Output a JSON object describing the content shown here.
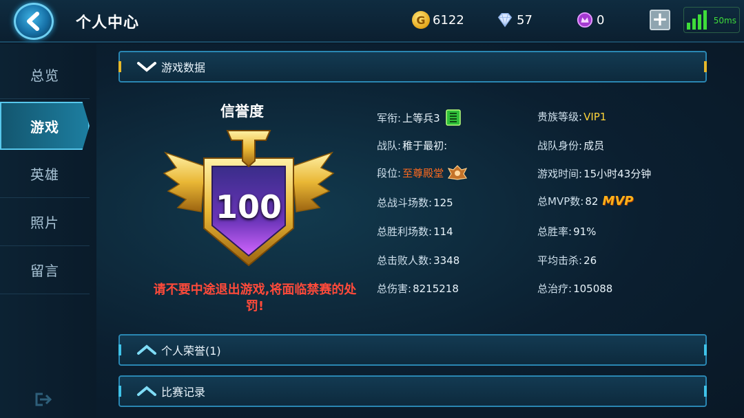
{
  "header": {
    "title": "个人中心"
  },
  "resources": {
    "gold": "6122",
    "diamond": "57",
    "crystal": "0",
    "latency": "50ms"
  },
  "sidebar": {
    "items": [
      {
        "label": "总览"
      },
      {
        "label": "游戏"
      },
      {
        "label": "英雄"
      },
      {
        "label": "照片"
      },
      {
        "label": "留言"
      }
    ]
  },
  "sections": {
    "game_data": "游戏数据",
    "honors": "个人荣誉(1)",
    "records": "比赛记录"
  },
  "honor": {
    "title": "信誉度",
    "score": "100",
    "warning": "请不要中途退出游戏,将面临禁赛的处罚!"
  },
  "stats": {
    "rank_label": "军衔:",
    "rank_value": "上等兵3",
    "vip_label": "贵族等级:",
    "vip_value": "VIP1",
    "team_label": "战队:",
    "team_value": "稚于最初:",
    "team_role_label": "战队身份:",
    "team_role_value": "成员",
    "tier_label": "段位:",
    "tier_value": "至尊殿堂",
    "playtime_label": "游戏时间:",
    "playtime_value": "15小时43分钟",
    "matches_label": "总战斗场数:",
    "matches_value": "125",
    "mvp_label": "总MVP数:",
    "mvp_value": "82",
    "mvp_badge": "MVP",
    "wins_label": "总胜利场数:",
    "wins_value": "114",
    "winrate_label": "总胜率:",
    "winrate_value": "91%",
    "kills_label": "总击败人数:",
    "kills_value": "3348",
    "avg_kills_label": "平均击杀:",
    "avg_kills_value": "26",
    "damage_label": "总伤害:",
    "damage_value": "8215218",
    "healing_label": "总治疗:",
    "healing_value": "105088"
  }
}
